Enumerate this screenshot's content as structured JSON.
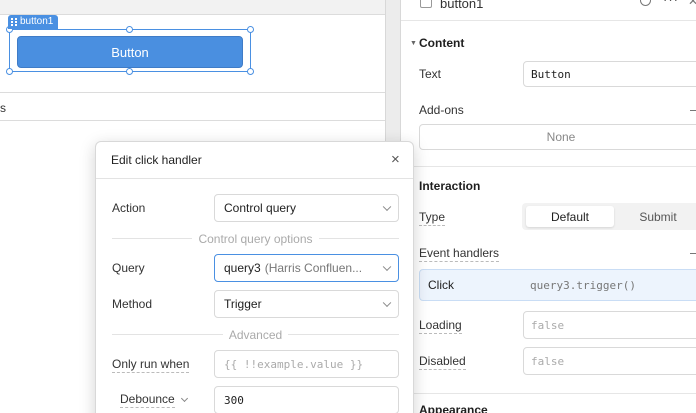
{
  "canvas": {
    "selection_tag": "button1",
    "button_label": "Button",
    "row_label": "s"
  },
  "inspector": {
    "title": "button1",
    "content": {
      "heading": "Content",
      "text_label": "Text",
      "text_value": "Button",
      "addons_label": "Add-ons",
      "addons_value": "None"
    },
    "interaction": {
      "heading": "Interaction",
      "type_label": "Type",
      "type_options": [
        "Default",
        "Submit"
      ],
      "event_handlers_label": "Event handlers",
      "handler_event": "Click",
      "handler_action": "query3.trigger()",
      "loading_label": "Loading",
      "loading_placeholder": "false",
      "disabled_label": "Disabled",
      "disabled_placeholder": "false"
    },
    "appearance_heading": "Appearance"
  },
  "modal": {
    "title": "Edit click handler",
    "close_glyph": "×",
    "action_label": "Action",
    "action_value": "Control query",
    "control_options_label": "Control query options",
    "query_label": "Query",
    "query_value": "query3",
    "query_hint": "(Harris Confluen...",
    "method_label": "Method",
    "method_value": "Trigger",
    "advanced_label": "Advanced",
    "only_run_label": "Only run when",
    "only_run_placeholder": "{{ !!example.value }}",
    "debounce_label": "Debounce",
    "debounce_value": "300"
  }
}
